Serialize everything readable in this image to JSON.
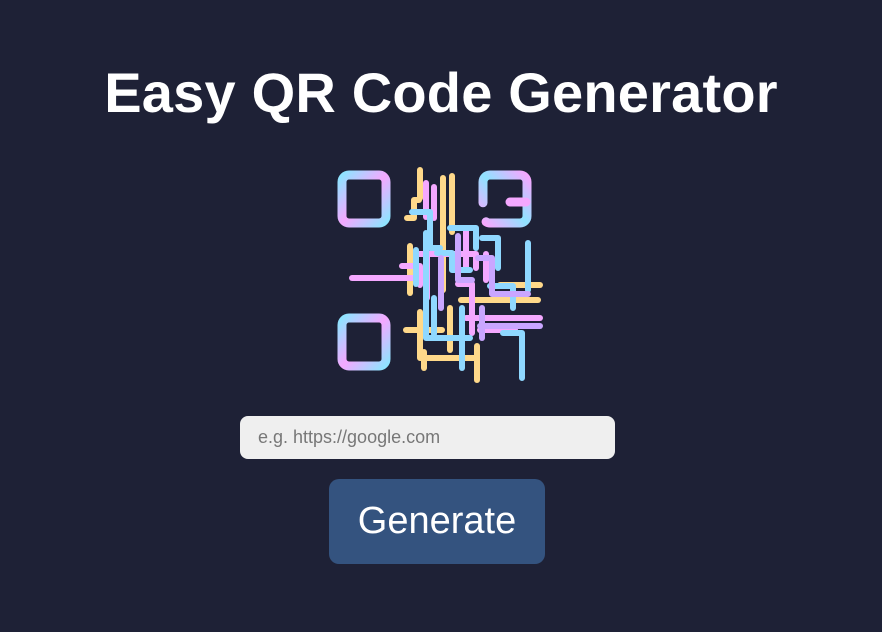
{
  "header": {
    "title": "Easy QR Code Generator"
  },
  "logo": {
    "icon": "qr-code-icon",
    "colors": [
      "#f9a8ff",
      "#8fe3ff",
      "#ffd98a",
      "#c9a6ff"
    ]
  },
  "form": {
    "url_placeholder": "e.g. https://google.com",
    "url_value": "",
    "generate_label": "Generate"
  },
  "colors": {
    "background": "#1e2136",
    "input_background": "#efefef",
    "button_background": "#34537f",
    "text": "#ffffff"
  }
}
